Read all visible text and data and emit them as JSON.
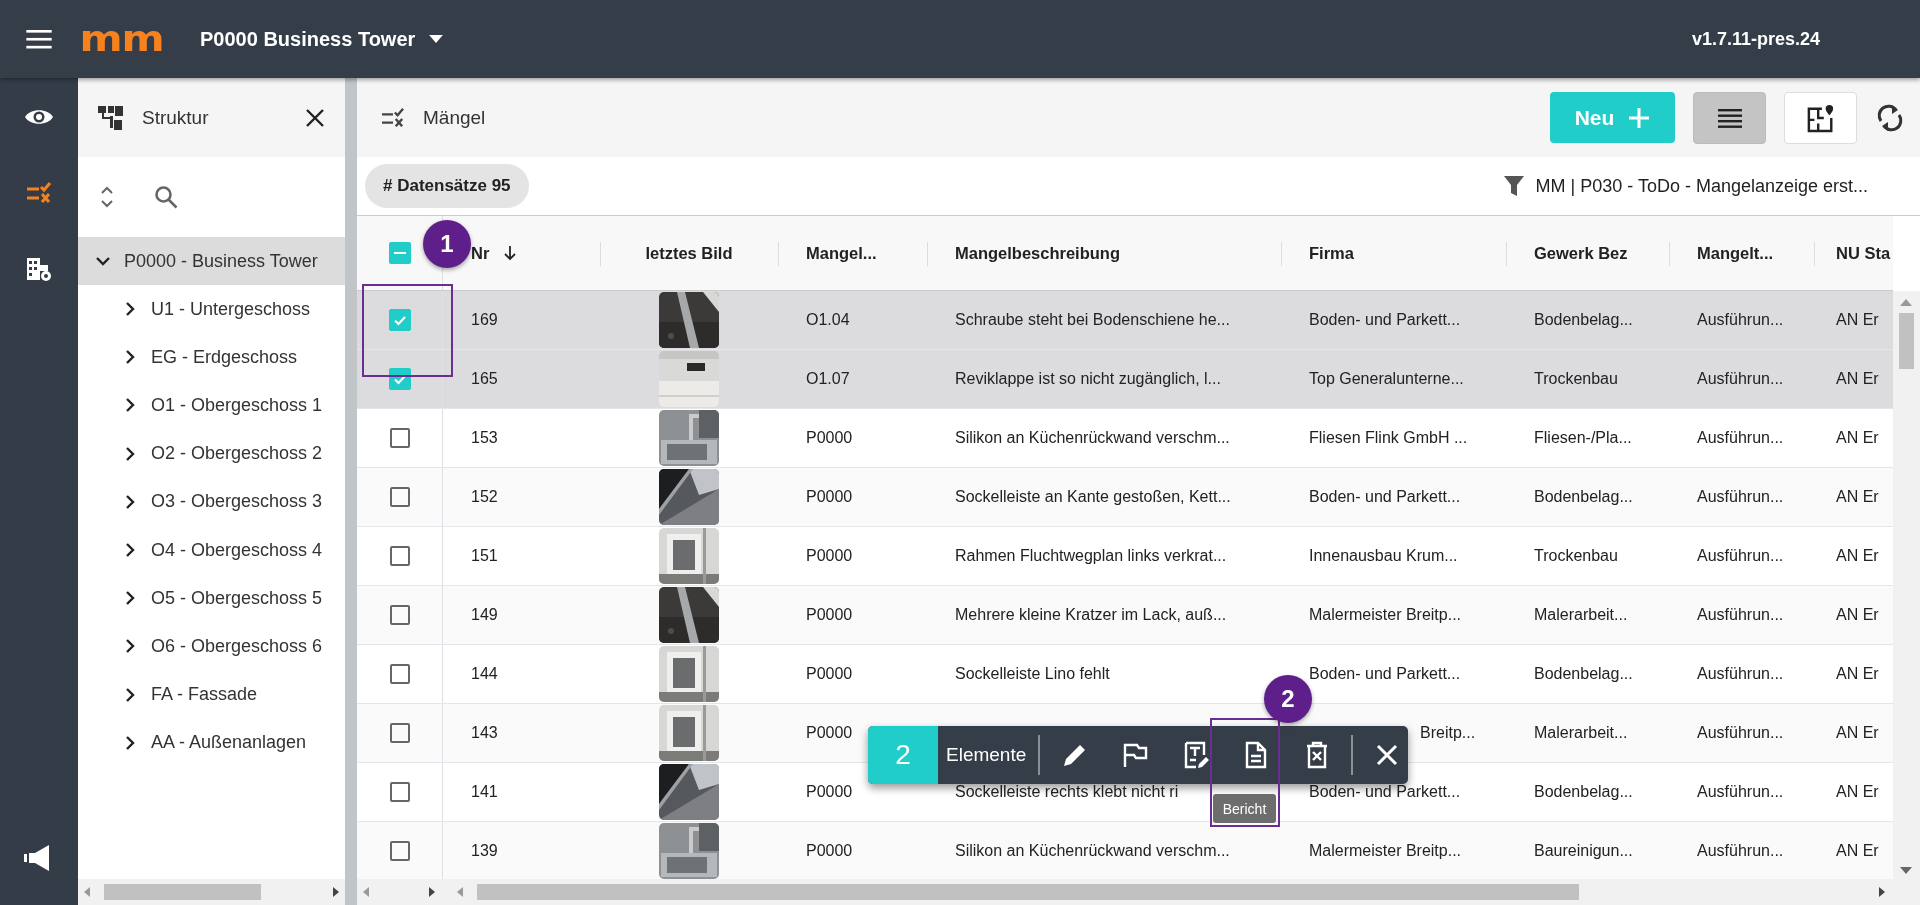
{
  "topbar": {
    "logo": "mm",
    "project": "P0000 Business Tower",
    "version": "v1.7.11-pres.24"
  },
  "rail": [
    {
      "kind": "eye",
      "selected": false
    },
    {
      "kind": "defects",
      "selected": true
    },
    {
      "kind": "buildings",
      "selected": false
    },
    {
      "kind": "announce",
      "selected": false
    }
  ],
  "sidebar": {
    "title": "Struktur",
    "tree": [
      {
        "label": "P0000 - Business Tower",
        "expanded": true,
        "selected": true,
        "children": [
          {
            "label": "U1 - Untergeschoss",
            "expanded": false,
            "selected": false
          },
          {
            "label": "EG - Erdgeschoss",
            "expanded": false,
            "selected": false
          },
          {
            "label": "O1 - Obergeschoss 1",
            "expanded": false,
            "selected": false
          },
          {
            "label": "O2 - Obergeschoss 2",
            "expanded": false,
            "selected": false
          },
          {
            "label": "O3 - Obergeschoss 3",
            "expanded": false,
            "selected": false
          },
          {
            "label": "O4 - Obergeschoss 4",
            "expanded": false,
            "selected": false
          },
          {
            "label": "O5 - Obergeschoss 5",
            "expanded": false,
            "selected": false
          },
          {
            "label": "O6 - Obergeschoss 6",
            "expanded": false,
            "selected": false
          },
          {
            "label": "FA - Fassade",
            "expanded": false,
            "selected": false
          },
          {
            "label": "AA - Außenanlagen",
            "expanded": false,
            "selected": false
          }
        ]
      }
    ]
  },
  "page": {
    "title": "Mängel",
    "new_button": "Neu",
    "view_buttons": [
      {
        "kind": "list",
        "selected": true
      },
      {
        "kind": "plan",
        "selected": false
      }
    ]
  },
  "record_chip": "# Datensätze 95",
  "filter": "MM | P030 - ToDo - Mangelanzeige erst...",
  "table": {
    "select_all": {
      "indeterminate": true
    },
    "columns": [
      {
        "label": "Nr",
        "sorted_descending": true
      },
      {
        "label": "letztes Bild"
      },
      {
        "label": "Mangel..."
      },
      {
        "label": "Mangelbeschreibung"
      },
      {
        "label": "Firma"
      },
      {
        "label": "Gewerk Bez"
      },
      {
        "label": "Mangelt..."
      },
      {
        "label": "NU Sta"
      }
    ],
    "rows": [
      {
        "checked": true,
        "covered": false,
        "nr": "169",
        "location": "O1.04",
        "description": "Schraube steht bei Bodenschiene he...",
        "firma": "Boden- und Parkett...",
        "gewerk": "Bodenbelag...",
        "status": "Ausführun...",
        "nu": "AN Er"
      },
      {
        "checked": true,
        "covered": false,
        "nr": "165",
        "location": "O1.07",
        "description": "Reviklappe ist so nicht zugänglich, l...",
        "firma": "Top Generalunterne...",
        "gewerk": "Trockenbau",
        "status": "Ausführun...",
        "nu": "AN Er"
      },
      {
        "checked": false,
        "covered": false,
        "nr": "153",
        "location": "P0000",
        "description": "Silikon an Küchenrückwand verschm...",
        "firma": "Fliesen Flink GmbH ...",
        "gewerk": "Fliesen-/Pla...",
        "status": "Ausführun...",
        "nu": "AN Er"
      },
      {
        "checked": false,
        "covered": false,
        "nr": "152",
        "location": "P0000",
        "description": "Sockelleiste an Kante gestoßen, Kett...",
        "firma": "Boden- und Parkett...",
        "gewerk": "Bodenbelag...",
        "status": "Ausführun...",
        "nu": "AN Er"
      },
      {
        "checked": false,
        "covered": false,
        "nr": "151",
        "location": "P0000",
        "description": "Rahmen Fluchtwegplan links verkrat...",
        "firma": "Innenausbau Krum...",
        "gewerk": "Trockenbau",
        "status": "Ausführun...",
        "nu": "AN Er"
      },
      {
        "checked": false,
        "covered": false,
        "nr": "149",
        "location": "P0000",
        "description": "Mehrere kleine Kratzer im Lack, auß...",
        "firma": "Malermeister Breitp...",
        "gewerk": "Malerarbeit...",
        "status": "Ausführun...",
        "nu": "AN Er"
      },
      {
        "checked": false,
        "covered": false,
        "nr": "144",
        "location": "P0000",
        "description": "Sockelleiste Lino fehlt",
        "firma": "Boden- und Parkett...",
        "gewerk": "Bodenbelag...",
        "status": "Ausführun...",
        "nu": "AN Er"
      },
      {
        "checked": false,
        "covered": true,
        "nr": "143",
        "location": "P0000",
        "firma": "Breitp...",
        "gewerk": "Malerarbeit...",
        "status": "Ausführun...",
        "nu": "AN Er"
      },
      {
        "checked": false,
        "covered": false,
        "nr": "141",
        "location": "P0000",
        "description": "Sockelleiste rechts klebt nicht ri",
        "firma": "Boden- und Parkett...",
        "gewerk": "Bodenbelag...",
        "status": "Ausführun...",
        "nu": "AN Er"
      },
      {
        "checked": false,
        "covered": false,
        "nr": "139",
        "location": "P0000",
        "description": "Silikon an Küchenrückwand verschm...",
        "firma": "Malermeister Breitp...",
        "gewerk": "Baureinigun...",
        "status": "Ausführun...",
        "nu": "AN Er"
      }
    ]
  },
  "selection_bar": {
    "count": "2",
    "label": "Elemente",
    "tooltip": "Bericht"
  },
  "annotations": [
    {
      "label": "1"
    },
    {
      "label": "2"
    }
  ]
}
